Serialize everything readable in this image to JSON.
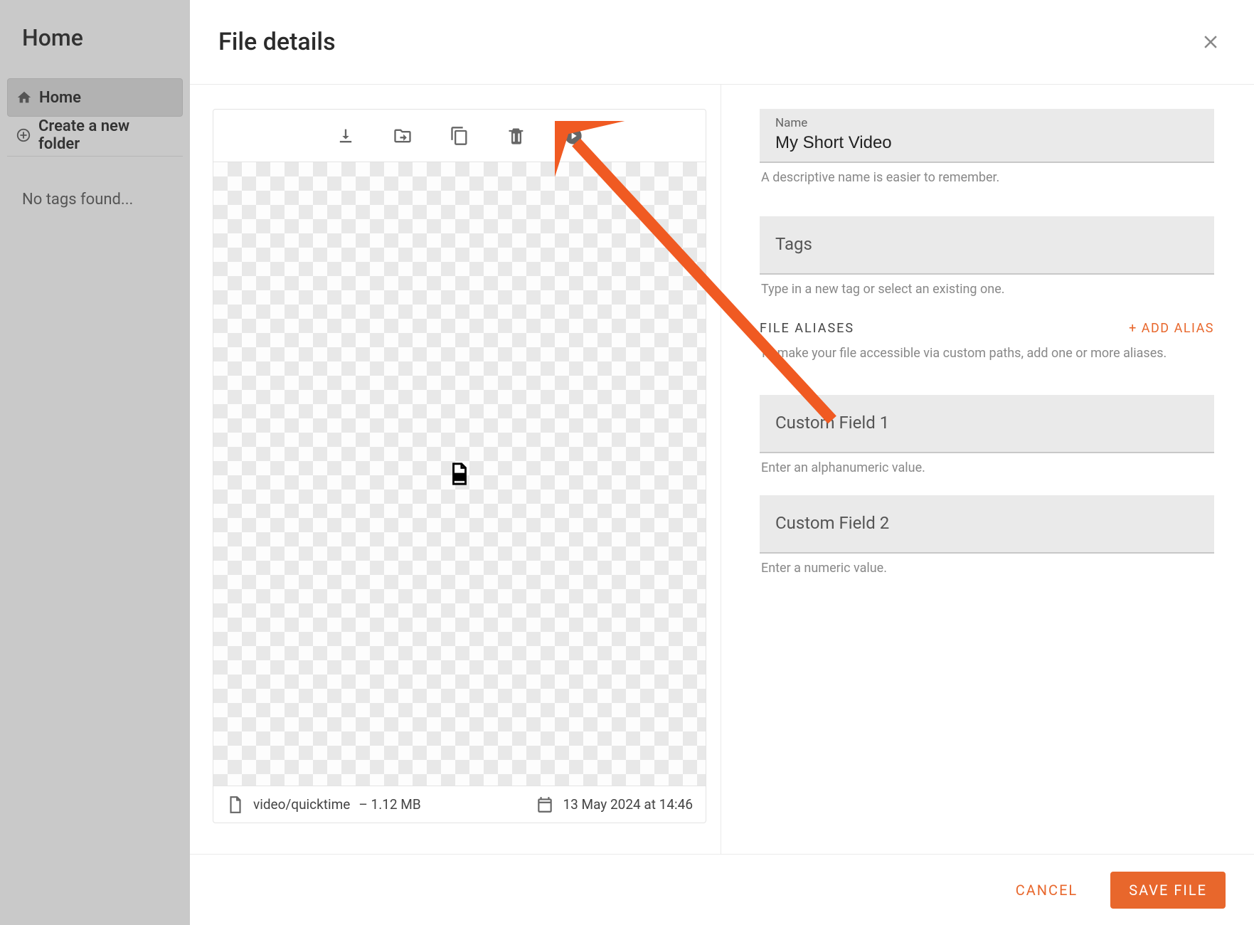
{
  "background": {
    "title": "Home",
    "nav_home": "Home",
    "nav_create": "Create a new folder",
    "no_tags": "No tags found..."
  },
  "modal": {
    "title": "File details",
    "preview": {
      "mime": "video/quicktime",
      "size": "1.12 MB",
      "date": "13 May 2024 at 14:46"
    },
    "form": {
      "name_label": "Name",
      "name_value": "My Short Video",
      "name_helper": "A descriptive name is easier to remember.",
      "tags_label": "Tags",
      "tags_helper": "Type in a new tag or select an existing one.",
      "aliases_title": "FILE ALIASES",
      "add_alias": "+ ADD ALIAS",
      "aliases_helper": "To make your file accessible via custom paths, add one or more aliases.",
      "cf1_label": "Custom Field 1",
      "cf1_helper": "Enter an alphanumeric value.",
      "cf2_label": "Custom Field 2",
      "cf2_helper": "Enter a numeric value."
    },
    "footer": {
      "cancel": "CANCEL",
      "save": "SAVE FILE"
    }
  }
}
